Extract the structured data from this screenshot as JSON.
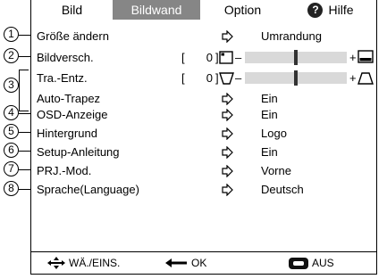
{
  "tabs": [
    {
      "label": "Bild",
      "active": false
    },
    {
      "label": "Bildwand",
      "active": true
    },
    {
      "label": "Option",
      "active": false
    },
    {
      "label": "Hilfe",
      "active": false
    }
  ],
  "callouts": [
    "1",
    "2",
    "3",
    "4",
    "5",
    "6",
    "7",
    "8"
  ],
  "menu": [
    {
      "label": "Größe ändern",
      "value": "Umrandung"
    },
    {
      "label": "Bildversch.",
      "open_bracket": "[",
      "number": "0",
      "close_bracket": "]",
      "slider_level": 0.5
    },
    {
      "label": "Tra.-Entz.",
      "open_bracket": "[",
      "number": "0",
      "close_bracket": "]",
      "slider_level": 0.5
    },
    {
      "label": "Auto-Trapez",
      "value": "Ein"
    },
    {
      "label": "OSD-Anzeige",
      "value": "Ein"
    },
    {
      "label": "Hintergrund",
      "value": "Logo"
    },
    {
      "label": "Setup-Anleitung",
      "value": "Ein"
    },
    {
      "label": "PRJ.-Mod.",
      "value": "Vorne"
    },
    {
      "label": "Sprache(Language)",
      "value": "Deutsch"
    }
  ],
  "slider_signs": {
    "minus": "–",
    "plus": "+"
  },
  "footer": {
    "select_label": "WÄ./EINS.",
    "ok_label": "OK",
    "exit_label": "AUS"
  },
  "colors": {
    "active_tab_bg": "#868686",
    "slider_track": "#d9d9d9"
  },
  "icons": [
    "help-icon",
    "arrow-right-icon",
    "screen-shift-icon",
    "trapezoid-icon",
    "four-way-arrows-icon",
    "enter-arrow-icon",
    "menu-button-icon"
  ]
}
